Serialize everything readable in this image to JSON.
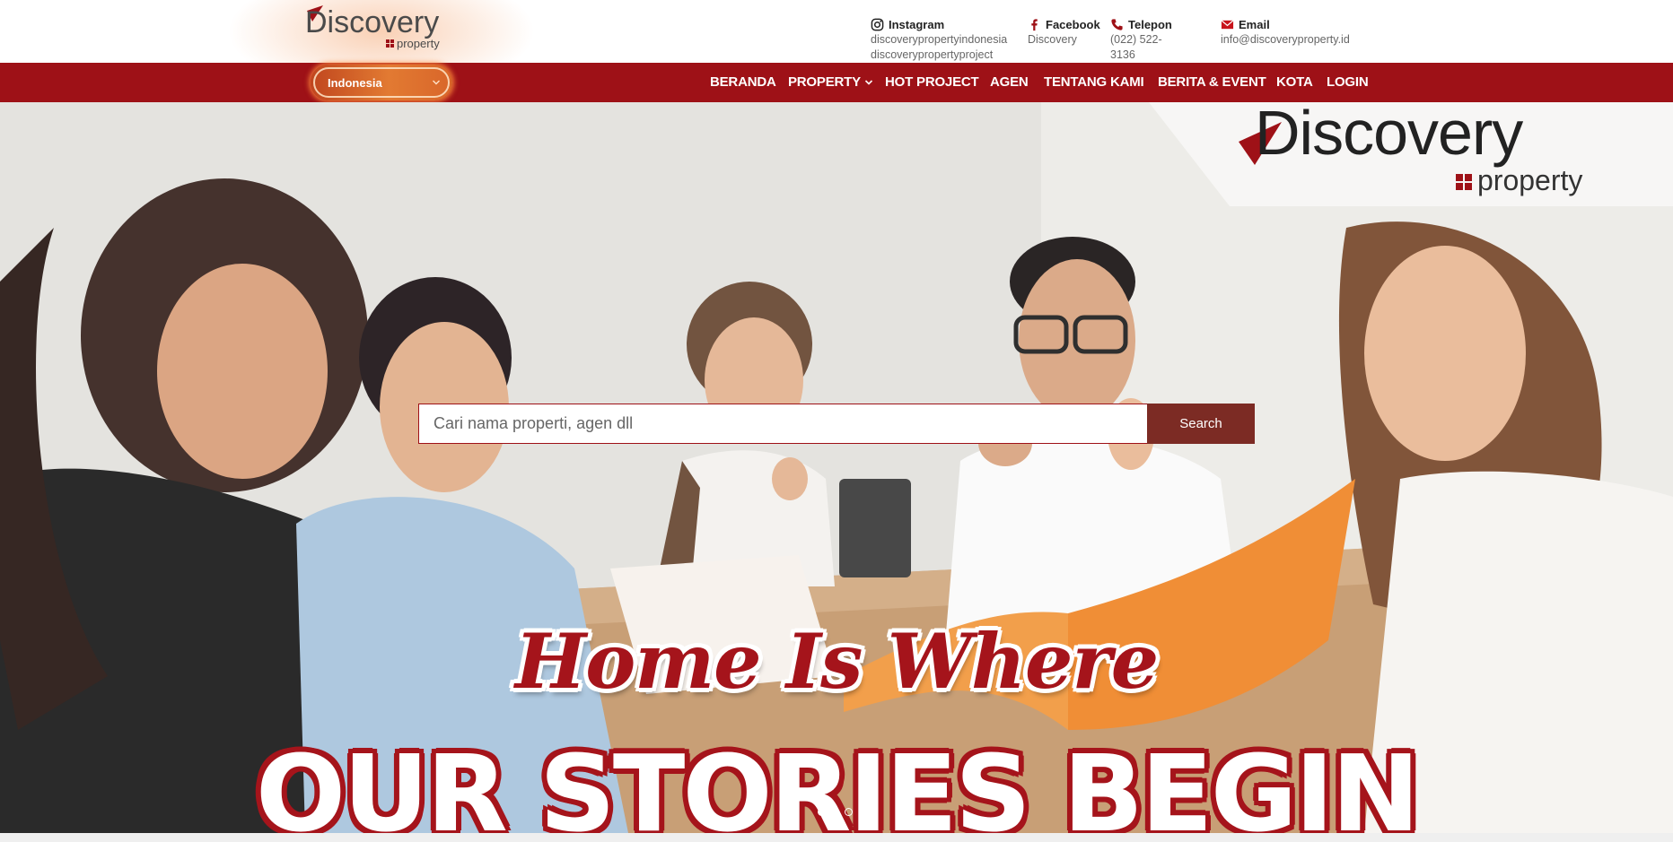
{
  "header": {
    "logo": {
      "word": "Discovery",
      "sub": "property"
    },
    "contacts": [
      {
        "icon": "instagram-icon",
        "label": "Instagram",
        "values": [
          "discoverypropertyindonesia",
          "discoverypropertyproject"
        ]
      },
      {
        "icon": "facebook-icon",
        "label": "Facebook",
        "values": [
          "Discovery"
        ]
      },
      {
        "icon": "phone-icon",
        "label": "Telepon",
        "values": [
          "(022) 522-3136"
        ]
      },
      {
        "icon": "email-icon",
        "label": "Email",
        "values": [
          "info@discoveryproperty.id"
        ]
      }
    ]
  },
  "nav": {
    "country": "Indonesia",
    "items": [
      "BERANDA",
      "PROPERTY",
      "HOT PROJECT",
      "AGEN",
      "TENTANG KAMI",
      "BERITA & EVENT",
      "KOTA",
      "LOGIN"
    ]
  },
  "hero": {
    "brand": {
      "word": "Discovery",
      "sub": "property"
    },
    "search": {
      "placeholder": "Cari nama properti, agen dll",
      "value": "",
      "button": "Search"
    },
    "headline_1": "Home Is Where",
    "headline_2": "OUR STORIES BEGIN",
    "slides": {
      "count": 3,
      "active": 1
    }
  },
  "colors": {
    "brand_red": "#9e1117",
    "search_button": "#7c2b24",
    "headline_red": "#a5141b",
    "country_orange": "#e27a32"
  }
}
